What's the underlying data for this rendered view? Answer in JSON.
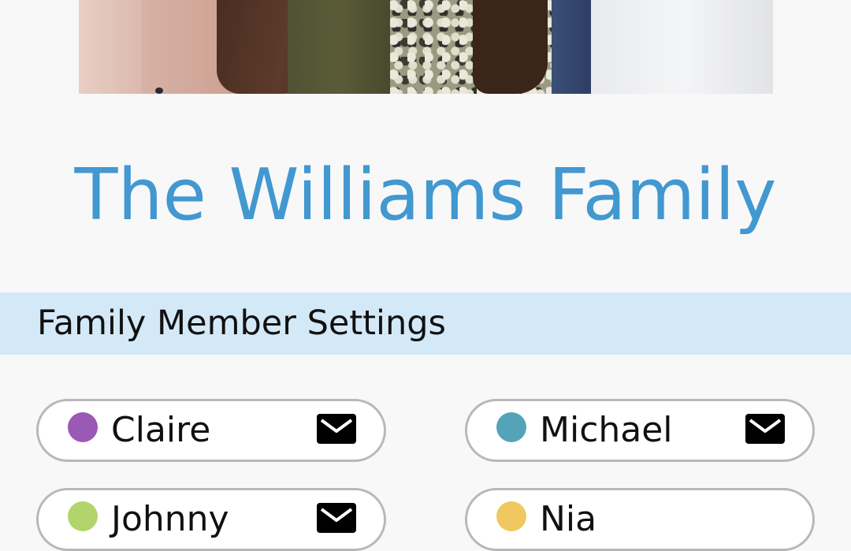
{
  "header": {
    "title": "The Williams Family"
  },
  "section": {
    "title": "Family Member Settings"
  },
  "members": [
    {
      "name": "Claire",
      "color": "#9a59b5",
      "icon": "mail-icon",
      "has_mail": true
    },
    {
      "name": "Michael",
      "color": "#55a3b9",
      "icon": "mail-icon",
      "has_mail": true
    },
    {
      "name": "Johnny",
      "color": "#b2d56b",
      "icon": "mail-icon",
      "has_mail": true
    },
    {
      "name": "Nia",
      "color": "#f1c75f",
      "icon": "",
      "has_mail": false
    }
  ],
  "colors": {
    "title": "#4298d0",
    "section_bg": "#d4e9f7",
    "page_bg": "#f8f8f8"
  }
}
